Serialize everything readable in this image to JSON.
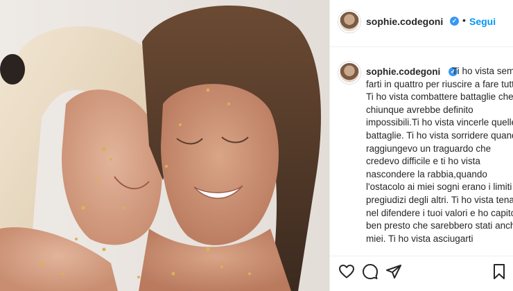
{
  "post": {
    "image_alt_icon": "photo-of-two-women-with-gold-leaf"
  },
  "header": {
    "username": "sophie.codegoni",
    "verified_icon": "verified-badge-icon",
    "separator": "•",
    "follow_label": "Segui"
  },
  "caption": {
    "username": "sophie.codegoni",
    "lines": [
      "Ti ho vista sempre",
      "farti in quattro per riuscire a fare tutto.",
      "Ti ho vista combattere battaglie che",
      "chiunque avrebbe definito",
      "impossibili.Ti ho vista vincerle quelle",
      "battaglie. Ti ho vista sorridere quando",
      "raggiungevo un traguardo che",
      "credevo difficile e ti ho vista",
      "nascondere la rabbia,quando",
      "l'ostacolo ai miei sogni erano i limiti e i",
      "pregiudizi degli altri. Ti ho vista tenace",
      "nel difendere i tuoi valori e ho capito",
      "ben presto che sarebbero stati anche i",
      "miei. Ti ho vista asciugarti"
    ]
  },
  "actions": {
    "like_icon": "heart-icon",
    "comment_icon": "comment-icon",
    "share_icon": "send-icon",
    "save_icon": "bookmark-icon"
  },
  "colors": {
    "accent": "#0095f6",
    "verified": "#3897f0",
    "text": "#262626",
    "divider": "#efefef"
  }
}
